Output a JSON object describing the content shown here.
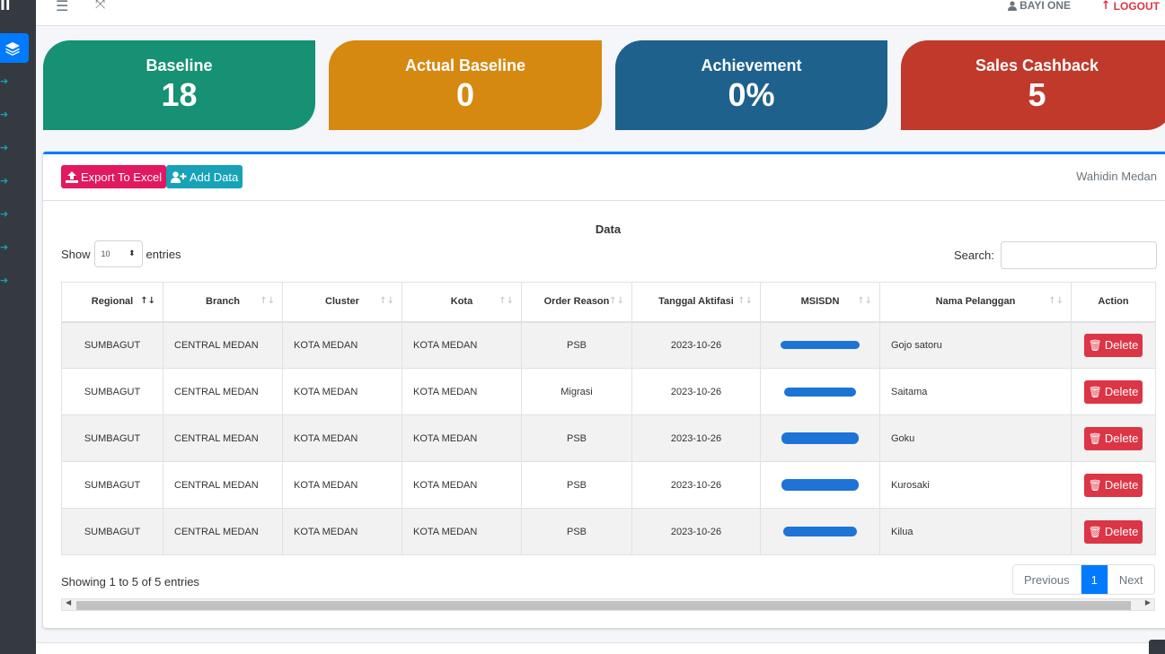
{
  "topbar": {
    "menu_icon": "bars-icon",
    "expand_icon": "expand-icon",
    "user_name": "BAYI ONE",
    "logout_label": "LOGOUT"
  },
  "cards": [
    {
      "label": "Baseline",
      "value": "18",
      "color": "#169173"
    },
    {
      "label": "Actual Baseline",
      "value": "0",
      "color": "#d68910"
    },
    {
      "label": "Achievement",
      "value": "0%",
      "color": "#1f618d"
    },
    {
      "label": "Sales Cashback",
      "value": "5",
      "color": "#c0392b"
    }
  ],
  "toolbar": {
    "export_label": "Export To Excel",
    "export_color": "#e21860",
    "add_label": "Add Data",
    "add_color": "#17a2b8",
    "owner": "Wahidin Medan"
  },
  "table": {
    "title": "Data",
    "show_label": "Show",
    "entries_label": "entries",
    "length_value": "10",
    "search_label": "Search:",
    "columns": [
      "Regional",
      "Branch",
      "Cluster",
      "Kota",
      "Order Reason",
      "Tanggal Aktifasi",
      "MSISDN",
      "Nama Pelanggan",
      "Action"
    ],
    "rows": [
      {
        "regional": "SUMBAGUT",
        "branch": "CENTRAL MEDAN",
        "cluster": "KOTA MEDAN",
        "kota": "KOTA MEDAN",
        "reason": "PSB",
        "tanggal": "2023-10-26",
        "nama": "Gojo satoru",
        "action": "Delete"
      },
      {
        "regional": "SUMBAGUT",
        "branch": "CENTRAL MEDAN",
        "cluster": "KOTA MEDAN",
        "kota": "KOTA MEDAN",
        "reason": "Migrasi",
        "tanggal": "2023-10-26",
        "nama": "Saitama",
        "action": "Delete"
      },
      {
        "regional": "SUMBAGUT",
        "branch": "CENTRAL MEDAN",
        "cluster": "KOTA MEDAN",
        "kota": "KOTA MEDAN",
        "reason": "PSB",
        "tanggal": "2023-10-26",
        "nama": "Goku",
        "action": "Delete"
      },
      {
        "regional": "SUMBAGUT",
        "branch": "CENTRAL MEDAN",
        "cluster": "KOTA MEDAN",
        "kota": "KOTA MEDAN",
        "reason": "PSB",
        "tanggal": "2023-10-26",
        "nama": "Kurosaki",
        "action": "Delete"
      },
      {
        "regional": "SUMBAGUT",
        "branch": "CENTRAL MEDAN",
        "cluster": "KOTA MEDAN",
        "kota": "KOTA MEDAN",
        "reason": "PSB",
        "tanggal": "2023-10-26",
        "nama": "Kilua",
        "action": "Delete"
      }
    ],
    "info": "Showing 1 to 5 of 5 entries",
    "pagination": {
      "previous": "Previous",
      "current": "1",
      "next": "Next"
    }
  }
}
